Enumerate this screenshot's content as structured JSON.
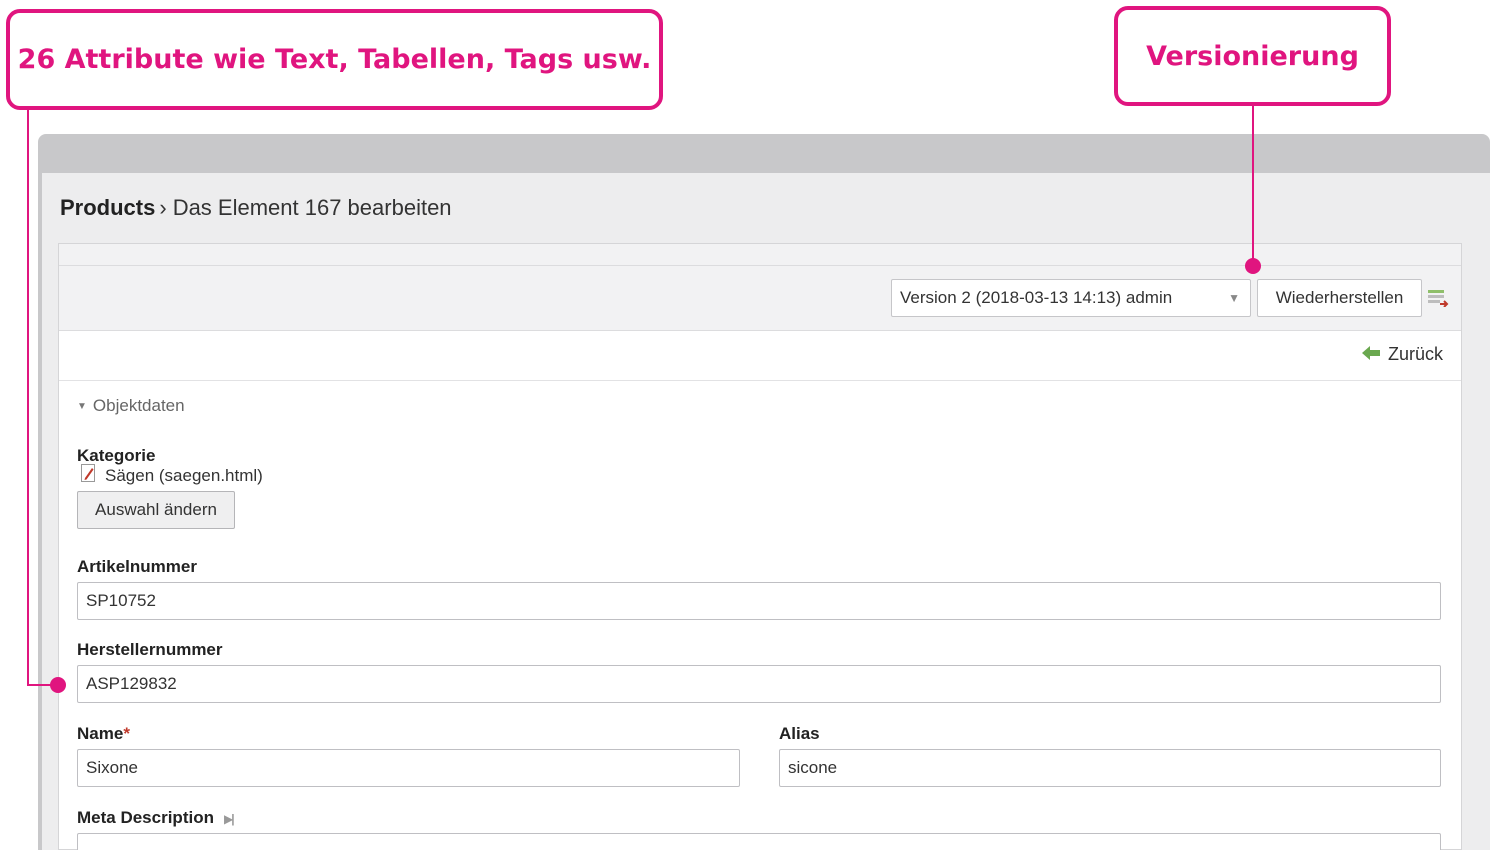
{
  "callouts": {
    "attributes": "26 Attribute wie Text, Tabellen, Tags usw.",
    "versioning": "Versionierung"
  },
  "breadcrumb": {
    "section": "Products",
    "separator": "›",
    "current": "Das Element 167 bearbeiten"
  },
  "version_bar": {
    "selected_version": "Version 2 (2018-03-13 14:13) admin",
    "restore_label": "Wiederherstellen"
  },
  "back_label": "Zurück",
  "section_title": "Objektdaten",
  "fields": {
    "category": {
      "label": "Kategorie",
      "value": "Sägen (saegen.html)",
      "change_label": "Auswahl ändern"
    },
    "article_number": {
      "label": "Artikelnummer",
      "value": "SP10752"
    },
    "manufacturer_number": {
      "label": "Herstellernummer",
      "value": "ASP129832"
    },
    "name": {
      "label": "Name",
      "required_mark": "*",
      "value": "Sixone"
    },
    "alias": {
      "label": "Alias",
      "value": "sicone"
    },
    "meta_description": {
      "label": "Meta Description"
    }
  },
  "colors": {
    "accent": "#e0157f",
    "back_arrow": "#6aa84f"
  },
  "icons": [
    "caret-down-icon",
    "compare-versions-icon",
    "back-arrow-icon",
    "collapse-triangle-icon",
    "document-edit-icon",
    "toggle-arrow-icon"
  ]
}
